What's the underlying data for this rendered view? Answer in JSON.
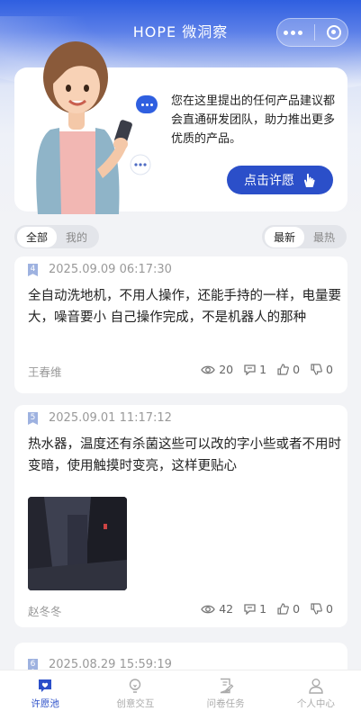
{
  "header": {
    "title": "HOPE 微洞察"
  },
  "intro": {
    "text": "您在这里提出的任何产品建议都会直通研发团队，助力推出更多优质的产品。",
    "cta_label": "点击许愿"
  },
  "filters": {
    "scope": [
      "全部",
      "我的"
    ],
    "scope_selected": "全部",
    "sort": [
      "最新",
      "最热"
    ],
    "sort_selected": "最新"
  },
  "posts": [
    {
      "num": "4",
      "date": "2025.09.09 06:17:30",
      "text": "全自动洗地机，不用人操作，还能手持的一样，电量要大，噪音要小 自己操作完成，不是机器人的那种",
      "author": "王春维",
      "views": "20",
      "comments": "1",
      "likes": "0",
      "dislikes": "0"
    },
    {
      "num": "5",
      "date": "2025.09.01 11:17:12",
      "text": "热水器，温度还有杀菌这些可以改的字小些或者不用时变暗，使用触摸时变亮，这样更贴心",
      "author": "赵冬冬",
      "views": "42",
      "comments": "1",
      "likes": "0",
      "dislikes": "0"
    },
    {
      "num": "6",
      "date": "2025.08.29 15:59:19"
    }
  ],
  "tabs": [
    {
      "label": "许愿池",
      "icon": "heart-chat-icon"
    },
    {
      "label": "创意交互",
      "icon": "lightbulb-icon"
    },
    {
      "label": "问卷任务",
      "icon": "survey-edit-icon"
    },
    {
      "label": "个人中心",
      "icon": "person-icon"
    }
  ],
  "colors": {
    "primary": "#2b4fc9",
    "header_blue": "#2f5fe0",
    "bg": "#f2f3f6"
  }
}
